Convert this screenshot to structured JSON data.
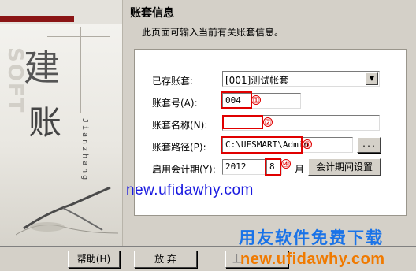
{
  "header": {
    "title": "账套信息",
    "subtitle": "此页面可输入当前有关账套信息。"
  },
  "left_panel": {
    "char1": "建",
    "char2": "账",
    "pinyin": "Jianzhang",
    "soft": "SOFT"
  },
  "form": {
    "existing_label": "已存账套:",
    "existing_value": "[001]测试帐套",
    "code_label": "账套号(A):",
    "code_value": "004",
    "name_label": "账套名称(N):",
    "name_value": "",
    "path_label": "账套路径(P):",
    "path_value": "C:\\UFSMART\\Admin",
    "browse_label": "...",
    "period_label": "启用会计期(Y):",
    "year_value": "2012",
    "month_value": "8",
    "month_unit": "月",
    "period_button": "会计期间设置"
  },
  "markers": [
    "①",
    "②",
    "③",
    "④"
  ],
  "watermark": {
    "url_top": "new.ufidawhy.com",
    "brand": "用友软件免费下载",
    "url_bottom": "new.ufidawhy.com"
  },
  "footer": {
    "help_label": "帮助(H)",
    "cancel_label": "放 弃",
    "prev_label": "上"
  },
  "colors": {
    "dialog_bg": "#d4d0c8",
    "annotation_red": "#e00000",
    "brand_blue": "#1a73e8",
    "url_blue": "#1a1ae0",
    "url_orange": "#f07a00",
    "accent_dark_red": "#8a1515"
  }
}
